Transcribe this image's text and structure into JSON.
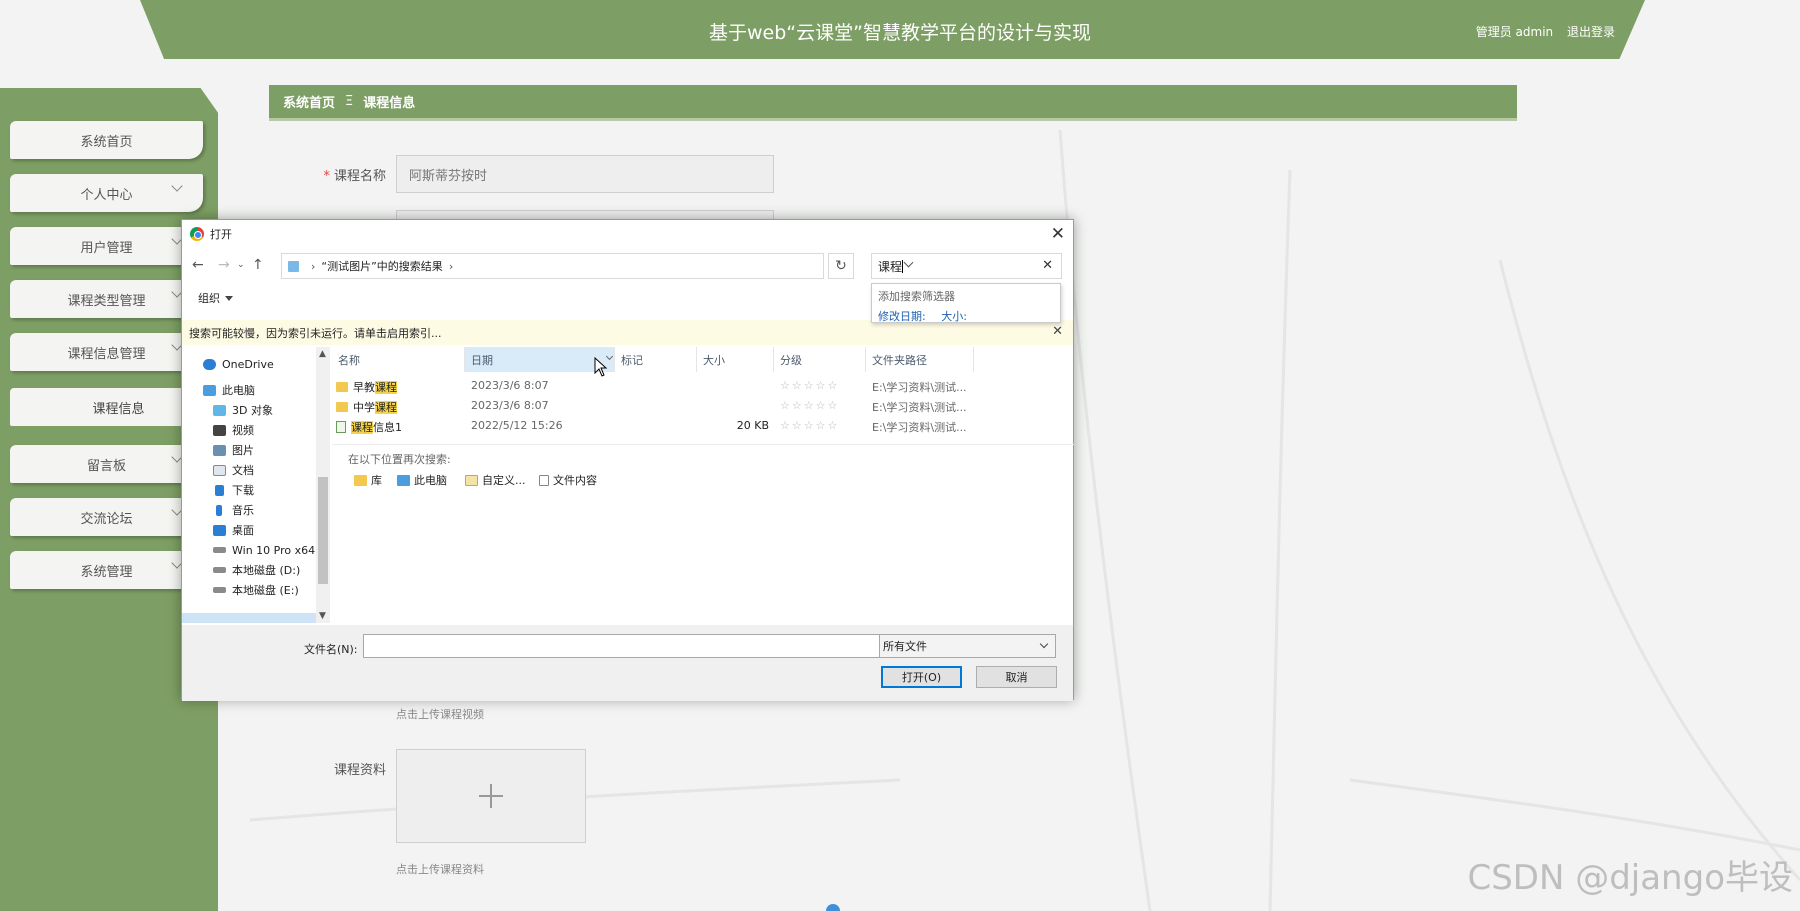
{
  "header": {
    "title": "基于web“云课堂”智慧教学平台的设计与实现",
    "user": "管理员 admin",
    "logout": "退出登录"
  },
  "sidebar": {
    "items": [
      {
        "label": "系统首页",
        "chevron": false
      },
      {
        "label": "个人中心",
        "chevron": true
      },
      {
        "label": "用户管理",
        "chevron": true
      },
      {
        "label": "课程类型管理",
        "chevron": true
      },
      {
        "label": "课程信息管理",
        "chevron": true
      },
      {
        "label": "课程信息",
        "chevron": false
      },
      {
        "label": "留言板",
        "chevron": true
      },
      {
        "label": "交流论坛",
        "chevron": true
      },
      {
        "label": "系统管理",
        "chevron": true
      }
    ]
  },
  "breadcrumb": {
    "home": "系统首页",
    "separator": "Ξ",
    "current": "课程信息"
  },
  "form": {
    "course_name_label": "课程名称",
    "course_name_value": "阿斯蒂芬按时",
    "video_hint": "点击上传课程视频",
    "material_label": "课程资料",
    "material_hint": "点击上传课程资料"
  },
  "dialog": {
    "title": "打开",
    "address": "“测试图片”中的搜索结果",
    "search_value": "课程",
    "search_dropdown": {
      "title": "添加搜索筛选器",
      "filter_date": "修改日期:",
      "filter_size": "大小:"
    },
    "organize": "组织",
    "info_bar": "搜索可能较慢，因为索引未运行。请单击启用索引...",
    "tree": [
      "OneDrive",
      "此电脑",
      "3D 对象",
      "视频",
      "图片",
      "文档",
      "下载",
      "音乐",
      "桌面",
      "Win 10 Pro x64",
      "本地磁盘 (D:)",
      "本地磁盘 (E:)"
    ],
    "columns": [
      "名称",
      "日期",
      "标记",
      "大小",
      "分级",
      "文件夹路径"
    ],
    "files": [
      {
        "prefix": "早教",
        "highlight": "课程",
        "suffix": "",
        "date": "2023/3/6 8:07",
        "size": "",
        "rating": "☆☆☆☆☆",
        "path": "E:\\学习资料\\测试...",
        "type": "folder"
      },
      {
        "prefix": "中学",
        "highlight": "课程",
        "suffix": "",
        "date": "2023/3/6 8:07",
        "size": "",
        "rating": "☆☆☆☆☆",
        "path": "E:\\学习资料\\测试...",
        "type": "folder"
      },
      {
        "prefix": "",
        "highlight": "课程",
        "suffix": "信息1",
        "date": "2022/5/12 15:26",
        "size": "20 KB",
        "rating": "☆☆☆☆☆",
        "path": "E:\\学习资料\\测试...",
        "type": "file"
      }
    ],
    "search_again_label": "在以下位置再次搜索:",
    "search_again": [
      "库",
      "此电脑",
      "自定义...",
      "文件内容"
    ],
    "filename_label": "文件名(N):",
    "filename_value": "",
    "filetype": "所有文件",
    "open_button": "打开(O)",
    "cancel_button": "取消"
  },
  "watermark": "CSDN @django毕设",
  "colors": {
    "theme_green": "#7d9e64",
    "highlight_yellow": "#f6d54b",
    "link_blue": "#1b62b5"
  }
}
